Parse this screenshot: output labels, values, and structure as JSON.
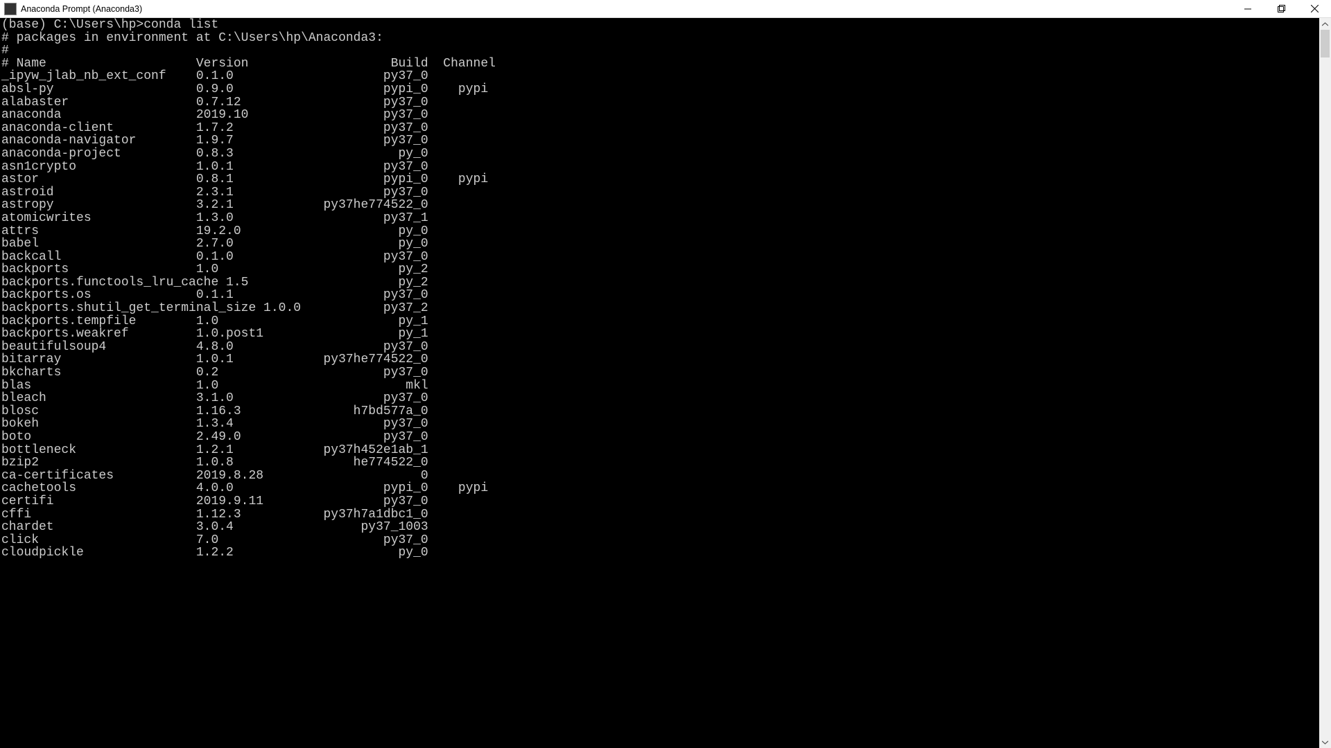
{
  "window": {
    "title": "Anaconda Prompt (Anaconda3)"
  },
  "terminal": {
    "prompt": "(base) C:\\Users\\hp>",
    "command": "conda list",
    "env_line": "# packages in environment at C:\\Users\\hp\\Anaconda3:",
    "header": {
      "name": "# Name",
      "version": "Version",
      "build": "Build",
      "channel": "Channel"
    },
    "packages": [
      {
        "name": "_ipyw_jlab_nb_ext_conf",
        "version": "0.1.0",
        "build": "py37_0",
        "channel": ""
      },
      {
        "name": "absl-py",
        "version": "0.9.0",
        "build": "pypi_0",
        "channel": "pypi"
      },
      {
        "name": "alabaster",
        "version": "0.7.12",
        "build": "py37_0",
        "channel": ""
      },
      {
        "name": "anaconda",
        "version": "2019.10",
        "build": "py37_0",
        "channel": ""
      },
      {
        "name": "anaconda-client",
        "version": "1.7.2",
        "build": "py37_0",
        "channel": ""
      },
      {
        "name": "anaconda-navigator",
        "version": "1.9.7",
        "build": "py37_0",
        "channel": ""
      },
      {
        "name": "anaconda-project",
        "version": "0.8.3",
        "build": "py_0",
        "channel": ""
      },
      {
        "name": "asn1crypto",
        "version": "1.0.1",
        "build": "py37_0",
        "channel": ""
      },
      {
        "name": "astor",
        "version": "0.8.1",
        "build": "pypi_0",
        "channel": "pypi"
      },
      {
        "name": "astroid",
        "version": "2.3.1",
        "build": "py37_0",
        "channel": ""
      },
      {
        "name": "astropy",
        "version": "3.2.1",
        "build": "py37he774522_0",
        "channel": ""
      },
      {
        "name": "atomicwrites",
        "version": "1.3.0",
        "build": "py37_1",
        "channel": ""
      },
      {
        "name": "attrs",
        "version": "19.2.0",
        "build": "py_0",
        "channel": ""
      },
      {
        "name": "babel",
        "version": "2.7.0",
        "build": "py_0",
        "channel": ""
      },
      {
        "name": "backcall",
        "version": "0.1.0",
        "build": "py37_0",
        "channel": ""
      },
      {
        "name": "backports",
        "version": "1.0",
        "build": "py_2",
        "channel": ""
      },
      {
        "name": "backports.functools_lru_cache",
        "version": "1.5",
        "build": "py_2",
        "channel": ""
      },
      {
        "name": "backports.os",
        "version": "0.1.1",
        "build": "py37_0",
        "channel": ""
      },
      {
        "name": "backports.shutil_get_terminal_size",
        "version": "1.0.0",
        "build": "py37_2",
        "channel": ""
      },
      {
        "name": "backports.tempfile",
        "version": "1.0",
        "build": "py_1",
        "channel": ""
      },
      {
        "name": "backports.weakref",
        "version": "1.0.post1",
        "build": "py_1",
        "channel": ""
      },
      {
        "name": "beautifulsoup4",
        "version": "4.8.0",
        "build": "py37_0",
        "channel": ""
      },
      {
        "name": "bitarray",
        "version": "1.0.1",
        "build": "py37he774522_0",
        "channel": ""
      },
      {
        "name": "bkcharts",
        "version": "0.2",
        "build": "py37_0",
        "channel": ""
      },
      {
        "name": "blas",
        "version": "1.0",
        "build": "mkl",
        "channel": ""
      },
      {
        "name": "bleach",
        "version": "3.1.0",
        "build": "py37_0",
        "channel": ""
      },
      {
        "name": "blosc",
        "version": "1.16.3",
        "build": "h7bd577a_0",
        "channel": ""
      },
      {
        "name": "bokeh",
        "version": "1.3.4",
        "build": "py37_0",
        "channel": ""
      },
      {
        "name": "boto",
        "version": "2.49.0",
        "build": "py37_0",
        "channel": ""
      },
      {
        "name": "bottleneck",
        "version": "1.2.1",
        "build": "py37h452e1ab_1",
        "channel": ""
      },
      {
        "name": "bzip2",
        "version": "1.0.8",
        "build": "he774522_0",
        "channel": ""
      },
      {
        "name": "ca-certificates",
        "version": "2019.8.28",
        "build": "0",
        "channel": ""
      },
      {
        "name": "cachetools",
        "version": "4.0.0",
        "build": "pypi_0",
        "channel": "pypi"
      },
      {
        "name": "certifi",
        "version": "2019.9.11",
        "build": "py37_0",
        "channel": ""
      },
      {
        "name": "cffi",
        "version": "1.12.3",
        "build": "py37h7a1dbc1_0",
        "channel": ""
      },
      {
        "name": "chardet",
        "version": "3.0.4",
        "build": "py37_1003",
        "channel": ""
      },
      {
        "name": "click",
        "version": "7.0",
        "build": "py37_0",
        "channel": ""
      },
      {
        "name": "cloudpickle",
        "version": "1.2.2",
        "build": "py_0",
        "channel": ""
      }
    ]
  }
}
